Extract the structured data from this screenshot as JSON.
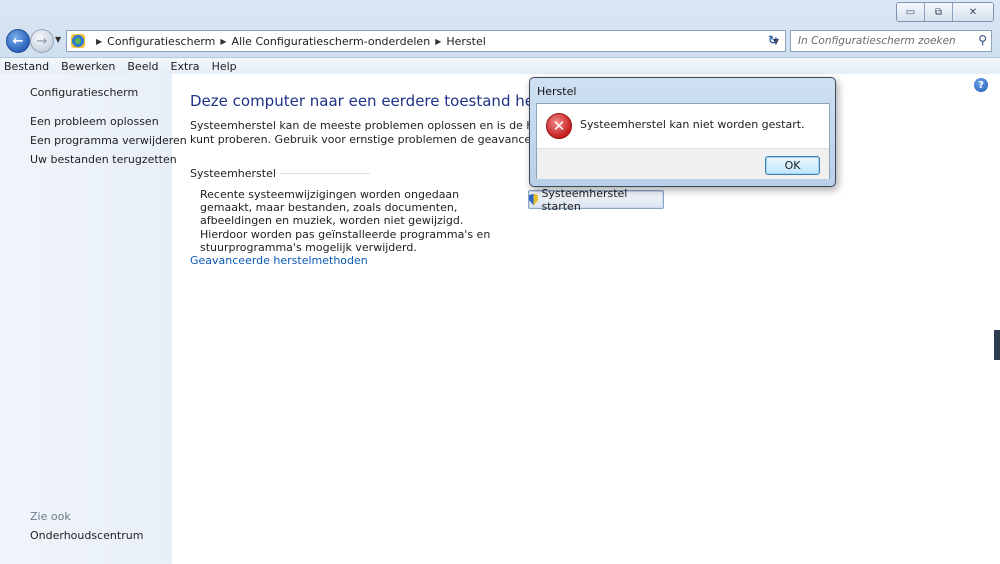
{
  "window": {
    "caption_buttons": {
      "minimize": "▭",
      "restore": "⧉",
      "close": "✕"
    }
  },
  "navigation": {
    "back_icon": "back-arrow-icon",
    "forward_icon": "forward-arrow-icon",
    "breadcrumbs": [
      "Configuratiescherm",
      "Alle Configuratiescherm-onderdelen",
      "Herstel"
    ],
    "search_placeholder": "In Configuratiescherm zoeken"
  },
  "menu": [
    "Bestand",
    "Bewerken",
    "Beeld",
    "Extra",
    "Help"
  ],
  "sidebar": {
    "home": "Configuratiescherm",
    "links": [
      "Een probleem oplossen",
      "Een programma verwijderen",
      "Uw bestanden terugzetten"
    ],
    "see_also_label": "Zie ook",
    "see_also_links": [
      "Onderhoudscentrum"
    ]
  },
  "main": {
    "title": "Deze computer naar een eerdere toestand herstellen",
    "description_line1": "Systeemherstel kan de meeste problemen oplossen en is de herstelmethode d",
    "description_line2": "kunt proberen. Gebruik voor ernstige problemen de geavanceerde herstelmet",
    "section_title": "Systeemherstel",
    "section_text": "Recente systeemwijzigingen worden ongedaan gemaakt, maar bestanden, zoals documenten, afbeeldingen en muziek, worden niet gewijzigd. Hierdoor worden pas geïnstalleerde programma's en stuurprogramma's mogelijk verwijderd.",
    "start_button": "Systeemherstel starten",
    "advanced_link": "Geavanceerde herstelmethoden"
  },
  "dialog": {
    "title": "Herstel",
    "message": "Systeemherstel kan niet worden gestart.",
    "ok_label": "OK"
  },
  "colors": {
    "title_blue": "#1e3287",
    "link_blue": "#0b5ab4",
    "error_red": "#c51e1e"
  }
}
